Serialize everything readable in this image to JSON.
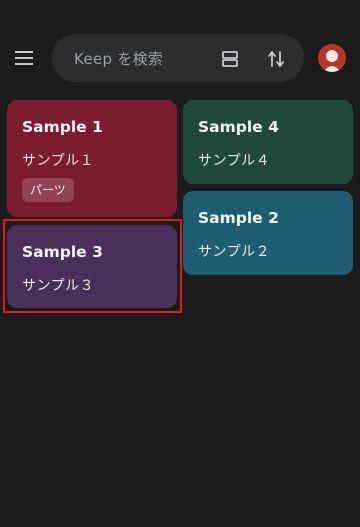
{
  "search": {
    "placeholder": "Keep を検索"
  },
  "icons": {
    "menu": "menu-icon",
    "view": "grid-view-icon",
    "sort": "sort-icon",
    "avatar": "avatar"
  },
  "notes": [
    {
      "title": "Sample 1",
      "body": "サンプル１",
      "label": "パーツ",
      "color": "#7b1c2f"
    },
    {
      "title": "Sample 3",
      "body": "サンプル３",
      "color": "#4a2f5a"
    },
    {
      "title": "Sample 4",
      "body": "サンプル４",
      "color": "#1f4a3b"
    },
    {
      "title": "Sample 2",
      "body": "サンプル２",
      "color": "#1f5e72"
    }
  ],
  "colors": {
    "background": "#1c1c1c",
    "searchbar": "#2c2d2f",
    "highlight": "#e01b1b"
  }
}
